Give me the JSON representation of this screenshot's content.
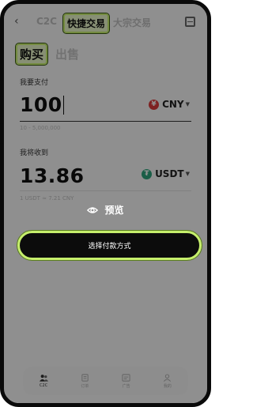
{
  "header": {
    "back_glyph": "‹",
    "tabs": [
      {
        "label": "C2C"
      },
      {
        "label": "快捷交易"
      },
      {
        "label": "大宗交易"
      }
    ]
  },
  "mode": {
    "buy": "购买",
    "sell": "出售"
  },
  "pay": {
    "label": "我要支付",
    "amount": "100",
    "currency": "CNY",
    "currency_symbol": "¥",
    "currency_color": "#d93a3a",
    "range": "10 - 5,000,000"
  },
  "receive": {
    "label": "我将收到",
    "amount": "13.86",
    "currency": "USDT",
    "currency_symbol": "₮",
    "currency_color": "#2ea37a",
    "rate": "1 USDT ≈ 7.21 CNY"
  },
  "action": {
    "select_payment": "选择付款方式"
  },
  "overlay": {
    "preview": "预览"
  },
  "nav": [
    {
      "label": "C2C",
      "icon": "users-icon",
      "active": true
    },
    {
      "label": "订单",
      "icon": "orders-icon",
      "active": false
    },
    {
      "label": "广告",
      "icon": "ads-icon",
      "active": false
    },
    {
      "label": "我的",
      "icon": "profile-icon",
      "active": false
    }
  ],
  "colors": {
    "accent": "#c6ef6c",
    "button": "#0c0c0c"
  }
}
